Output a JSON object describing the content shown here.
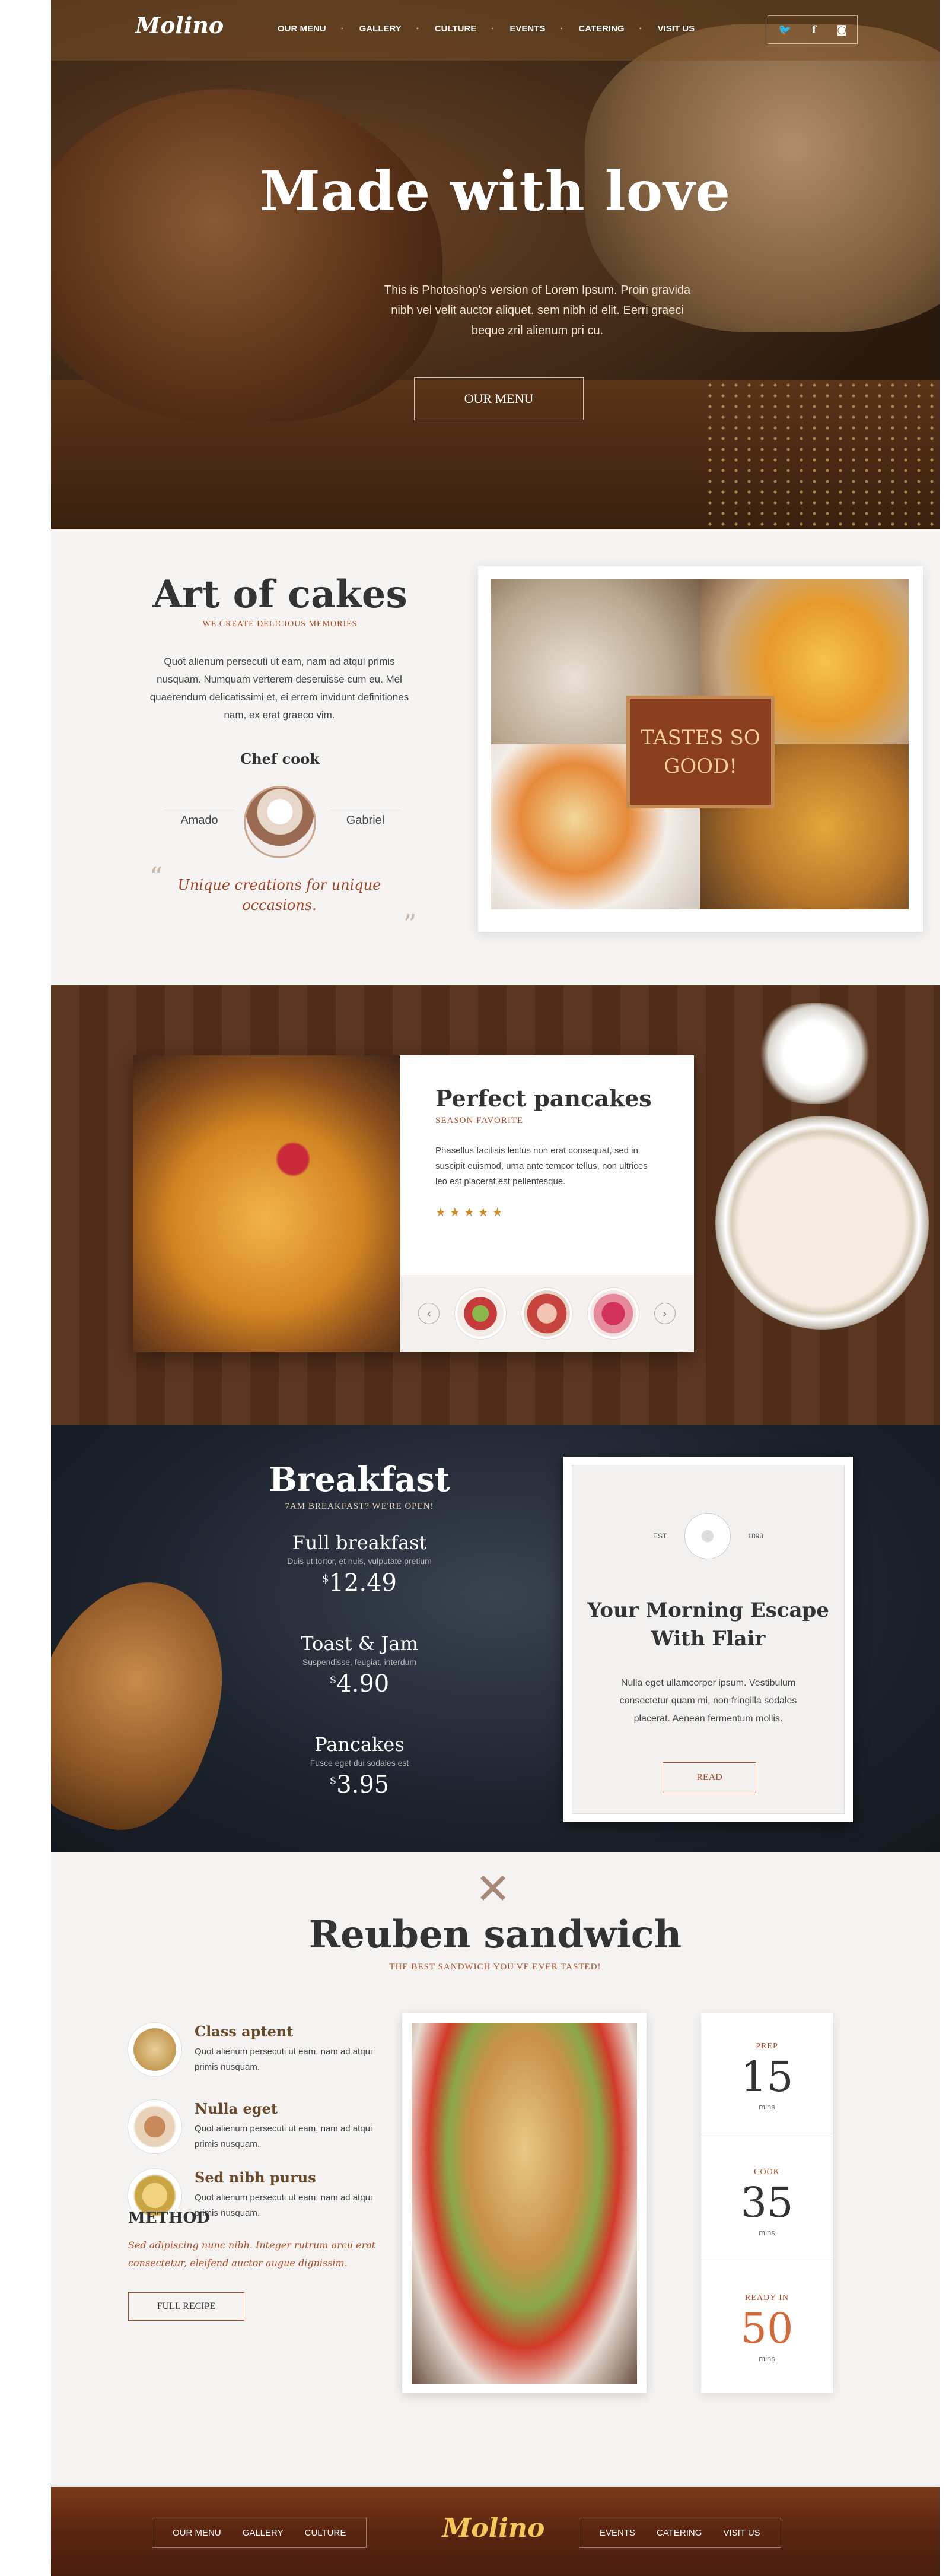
{
  "header": {
    "logo": "Molino",
    "nav": [
      "OUR MENU",
      "GALLERY",
      "CULTURE",
      "EVENTS",
      "CATERING",
      "VISIT US"
    ],
    "social_icons": [
      "twitter-icon",
      "facebook-icon",
      "instagram-icon"
    ]
  },
  "hero": {
    "title": "Made with love",
    "text": "This is Photoshop's version of Lorem Ipsum. Proin gravida nibh vel velit auctor aliquet. sem nibh id elit. Eerri graeci beque zril alienum pri cu.",
    "button": "OUR MENU"
  },
  "art": {
    "title": "Art of cakes",
    "subtitle": "WE CREATE DELICIOUS MEMORIES",
    "text": "Quot alienum persecuti ut eam, nam ad atqui primis nusquam. Numquam verterem deseruisse cum eu. Mel quaerendum delicatissimi et, ei errem invidunt definitiones nam, ex erat graeco vim.",
    "chef_label": "Chef cook",
    "chef_left": "Amado",
    "chef_right": "Gabriel",
    "quote": "Unique creations for unique occasions.",
    "overlay": "TASTES SO GOOD!"
  },
  "pancakes": {
    "title": "Perfect pancakes",
    "subtitle": "SEASON FAVORITE",
    "text": "Phasellus facilisis lectus non erat consequat, sed in suscipit euismod, urna ante tempor tellus, non ultrices leo est placerat est pellentesque.",
    "stars": "★★★★★",
    "rating": 5,
    "prev": "‹",
    "next": "›"
  },
  "breakfast": {
    "title": "Breakfast",
    "subtitle": "7AM BREAKFAST? WE'RE OPEN!",
    "items": [
      {
        "name": "Full breakfast",
        "desc": "Duis ut tortor, et nuis, vulputate pretium",
        "currency": "$",
        "price": "12.49"
      },
      {
        "name": "Toast & Jam",
        "desc": "Suspendisse, feugiat, interdum",
        "currency": "$",
        "price": "4.90"
      },
      {
        "name": "Pancakes",
        "desc": "Fusce eget dui sodales est",
        "currency": "$",
        "price": "3.95"
      }
    ],
    "card": {
      "est": "EST.",
      "year": "1893",
      "title": "Your Morning Escape With Flair",
      "text": "Nulla eget ullamcorper ipsum. Vestibulum consectetur quam mi, non fringilla sodales placerat. Aenean fermentum mollis.",
      "button": "READ"
    }
  },
  "reuben": {
    "title": "Reuben sandwich",
    "subtitle": "THE BEST SANDWICH YOU'VE EVER TASTED!",
    "ingredients": [
      {
        "name": "Class aptent",
        "text": "Quot alienum persecuti ut eam, nam ad atqui primis nusquam."
      },
      {
        "name": "Nulla eget",
        "text": "Quot alienum persecuti ut eam, nam ad atqui primis nusquam."
      },
      {
        "name": "Sed nibh purus",
        "text": "Quot alienum persecuti ut eam, nam ad atqui primis nusquam."
      }
    ],
    "method_label": "METHOD",
    "method_text": "Sed adipiscing nunc nibh. Integer rutrum arcu erat consectetur, eleifend auctor augue dignissim.",
    "button": "FULL RECIPE",
    "stats": [
      {
        "label": "PREP",
        "value": "15",
        "unit": "mins"
      },
      {
        "label": "COOK",
        "value": "35",
        "unit": "mins"
      },
      {
        "label": "READY IN",
        "value": "50",
        "unit": "mins"
      }
    ]
  },
  "footer": {
    "logo": "Molino",
    "nav_left": [
      "OUR MENU",
      "GALLERY",
      "CULTURE"
    ],
    "nav_right": [
      "EVENTS",
      "CATERING",
      "VISIT US"
    ]
  },
  "colors": {
    "accent": "#b24b26",
    "footer": "#5a2510"
  }
}
